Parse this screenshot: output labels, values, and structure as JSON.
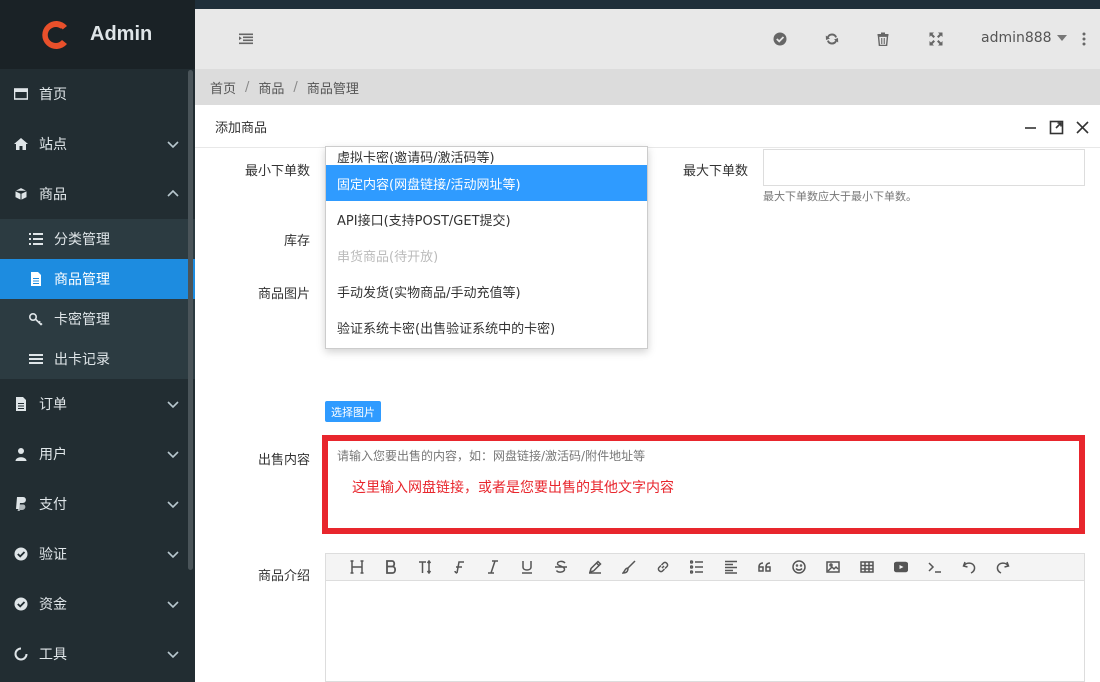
{
  "app": {
    "title": "Admin"
  },
  "sidebar": {
    "items": [
      {
        "label": "首页",
        "icon": "window-icon"
      },
      {
        "label": "站点",
        "icon": "home-icon"
      },
      {
        "label": "商品",
        "icon": "cube-icon"
      },
      {
        "label": "订单",
        "icon": "file-icon"
      },
      {
        "label": "用户",
        "icon": "user-icon"
      },
      {
        "label": "支付",
        "icon": "paypal-icon"
      },
      {
        "label": "验证",
        "icon": "check-circle-icon"
      },
      {
        "label": "资金",
        "icon": "check-circle-icon"
      },
      {
        "label": "工具",
        "icon": "circle-notch-icon"
      }
    ],
    "submenu": [
      {
        "label": "分类管理",
        "icon": "list-icon"
      },
      {
        "label": "商品管理",
        "icon": "file-text-icon",
        "active": true
      },
      {
        "label": "卡密管理",
        "icon": "key-icon"
      },
      {
        "label": "出卡记录",
        "icon": "bars-icon"
      }
    ]
  },
  "header": {
    "user": "admin888"
  },
  "breadcrumb": [
    "首页",
    "商品",
    "商品管理"
  ],
  "dialog": {
    "title": "添加商品",
    "form": {
      "min_qty_label": "最小下单数",
      "max_qty_label": "最大下单数",
      "max_qty_help": "最大下单数应大于最小下单数。",
      "stock_label": "库存",
      "image_label": "商品图片",
      "choose_image_button": "选择图片",
      "sale_content_label": "出售内容",
      "sale_content_placeholder": "请输入您要出售的内容，如：网盘链接/激活码/附件地址等",
      "sale_content_annotation": "这里输入网盘链接，或者是您要出售的其他文字内容",
      "intro_label": "商品介绍"
    },
    "delivery_options": [
      {
        "label": "虚拟卡密(邀请码/激活码等)",
        "state": "cut"
      },
      {
        "label": "固定内容(网盘链接/活动网址等)",
        "state": "selected"
      },
      {
        "label": "API接口(支持POST/GET提交)",
        "state": "normal"
      },
      {
        "label": "串货商品(待开放)",
        "state": "disabled"
      },
      {
        "label": "手动发货(实物商品/手动充值等)",
        "state": "normal"
      },
      {
        "label": "验证系统卡密(出售验证系统中的卡密)",
        "state": "normal"
      }
    ]
  },
  "editor_toolbar": [
    "heading",
    "bold",
    "text-height",
    "font",
    "italic",
    "underline",
    "strikethrough",
    "pencil",
    "brush",
    "link",
    "list-ul",
    "align-left",
    "quote",
    "smile",
    "image",
    "table",
    "video",
    "terminal",
    "undo",
    "redo"
  ],
  "colors": {
    "sidebar_bg": "#222d32",
    "accent": "#2f9bff",
    "annotation_red": "#e8262d"
  }
}
